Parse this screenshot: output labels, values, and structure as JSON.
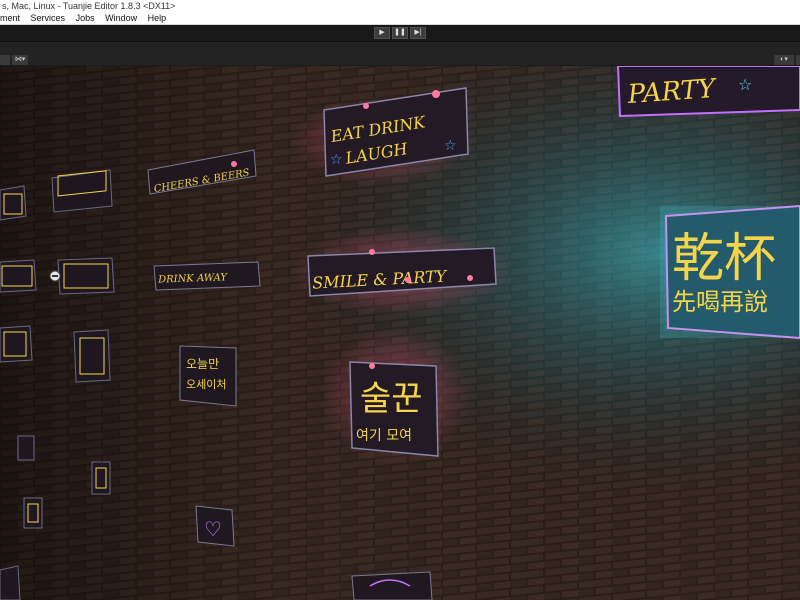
{
  "window": {
    "title": "s, Mac, Linux - Tuanjie Editor 1.8.3 <DX11>"
  },
  "menu": {
    "items": [
      "ment",
      "Services",
      "Jobs",
      "Window",
      "Help"
    ]
  },
  "toolbar": {
    "play_icon": "▶",
    "pause_icon": "❚❚",
    "step_icon": "▶|"
  },
  "scene": {
    "left_menu_icon": "⋈▾",
    "right_menu_icon": "◐▾",
    "signs": {
      "eat_drink_line1": "EAT DRINK",
      "eat_drink_line2": "LAUGH",
      "party_top": "PARTY",
      "smile_party": "SMILE & PARTY",
      "drink_away": "DRINK AWAY",
      "cheers_beers": "CHEERS & BEERS",
      "korean_main": "술꾼",
      "korean_sub": "여기 모여",
      "korean_small_line1": "오늘만",
      "korean_small_line2": "오세이처",
      "chinese_main": "乾杯",
      "chinese_sub": "先喝再說"
    }
  },
  "colors": {
    "neon_yellow": "#f5d44a",
    "neon_pink": "#ff4f7a",
    "neon_cyan": "#48e0ea",
    "wall": "#2a1f1b"
  }
}
